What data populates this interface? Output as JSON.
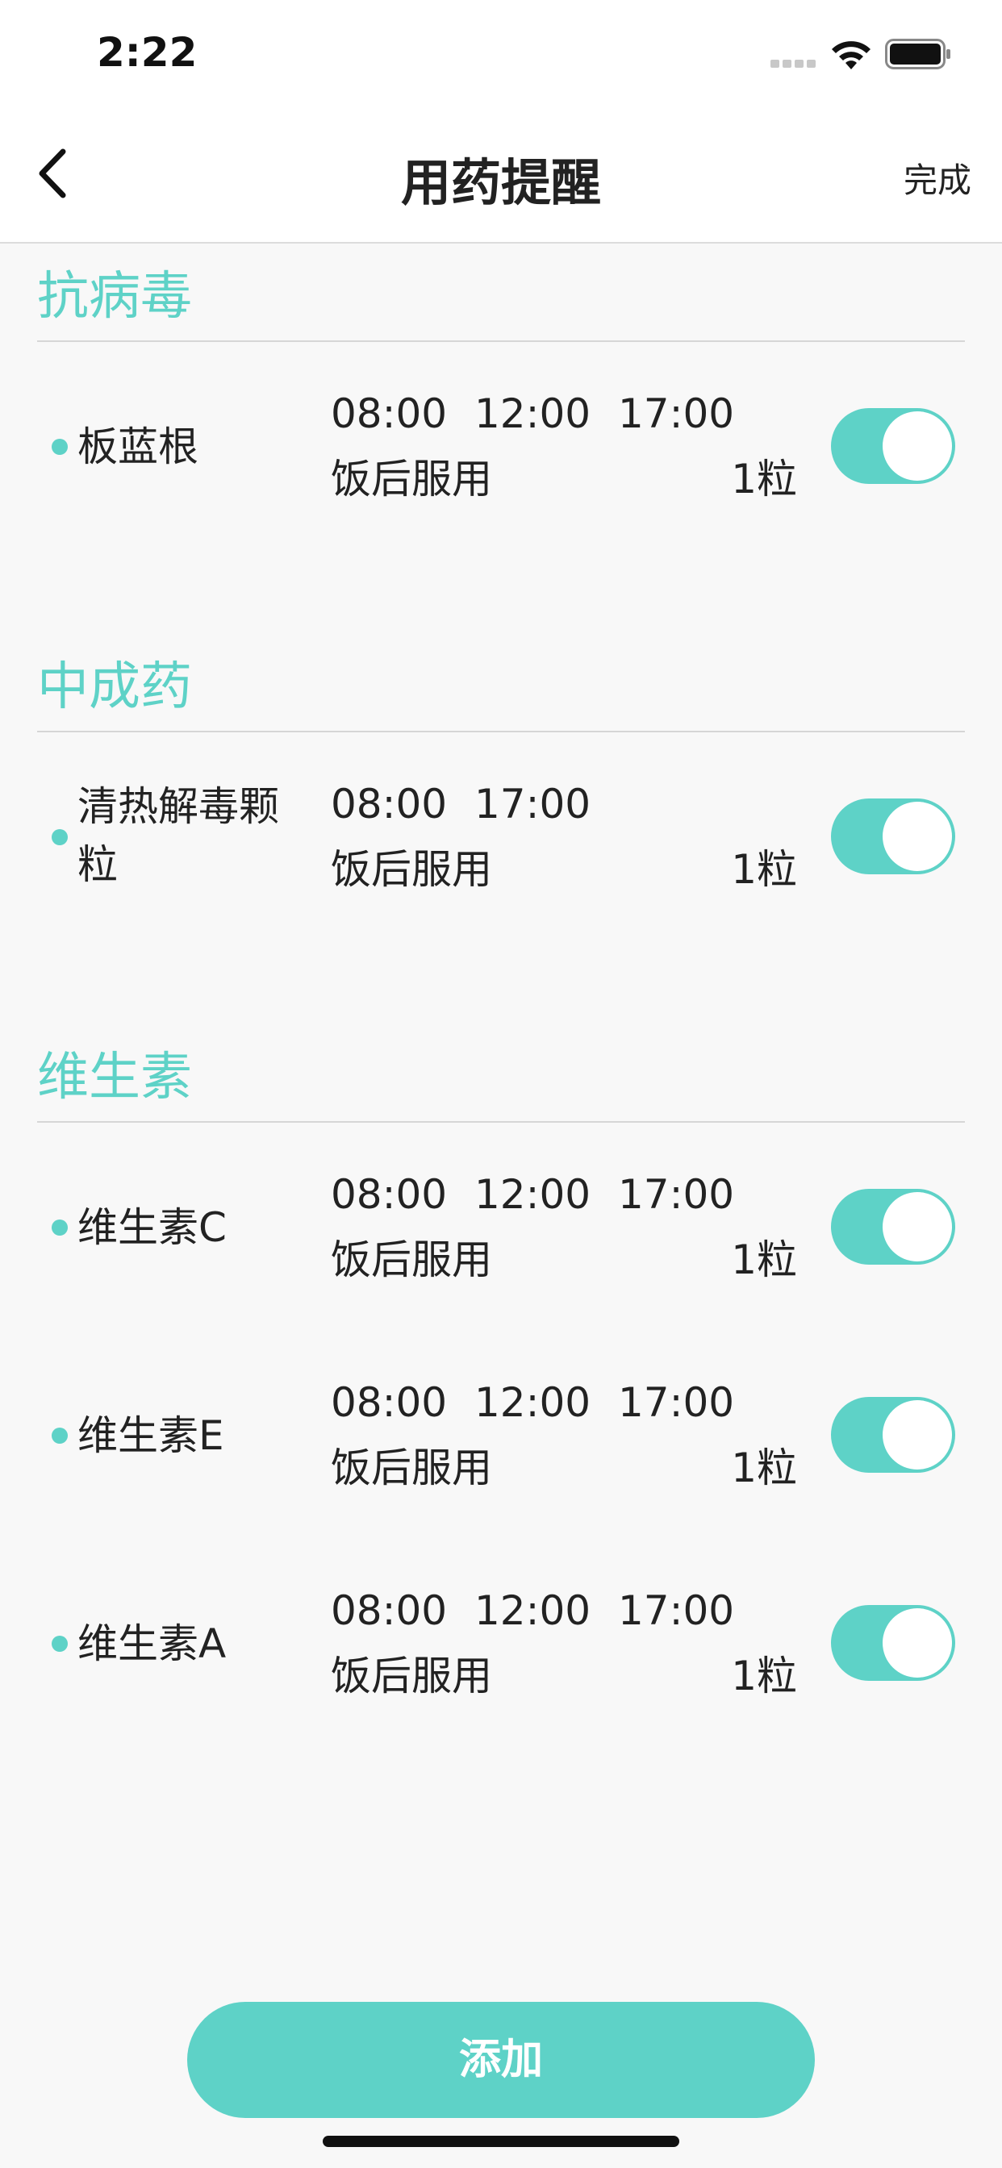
{
  "status_bar": {
    "time": "2:22",
    "wifi_icon": "wifi-icon",
    "battery_icon": "battery-icon"
  },
  "nav": {
    "back_icon": "chevron-left-icon",
    "title": "用药提醒",
    "done_label": "完成"
  },
  "colors": {
    "accent": "#5ed2c7",
    "background": "#f8f8f8"
  },
  "sections": [
    {
      "title": "抗病毒",
      "items": [
        {
          "name": "板蓝根",
          "times": [
            "08:00",
            "12:00",
            "17:00"
          ],
          "instruction": "饭后服用",
          "dose": "1粒",
          "enabled": true
        }
      ]
    },
    {
      "title": "中成药",
      "items": [
        {
          "name": "清热解毒颗粒",
          "times": [
            "08:00",
            "17:00"
          ],
          "instruction": "饭后服用",
          "dose": "1粒",
          "enabled": true
        }
      ]
    },
    {
      "title": "维生素",
      "items": [
        {
          "name": "维生素C",
          "times": [
            "08:00",
            "12:00",
            "17:00"
          ],
          "instruction": "饭后服用",
          "dose": "1粒",
          "enabled": true
        },
        {
          "name": "维生素E",
          "times": [
            "08:00",
            "12:00",
            "17:00"
          ],
          "instruction": "饭后服用",
          "dose": "1粒",
          "enabled": true
        },
        {
          "name": "维生素A",
          "times": [
            "08:00",
            "12:00",
            "17:00"
          ],
          "instruction": "饭后服用",
          "dose": "1粒",
          "enabled": true
        }
      ]
    }
  ],
  "add_button_label": "添加"
}
